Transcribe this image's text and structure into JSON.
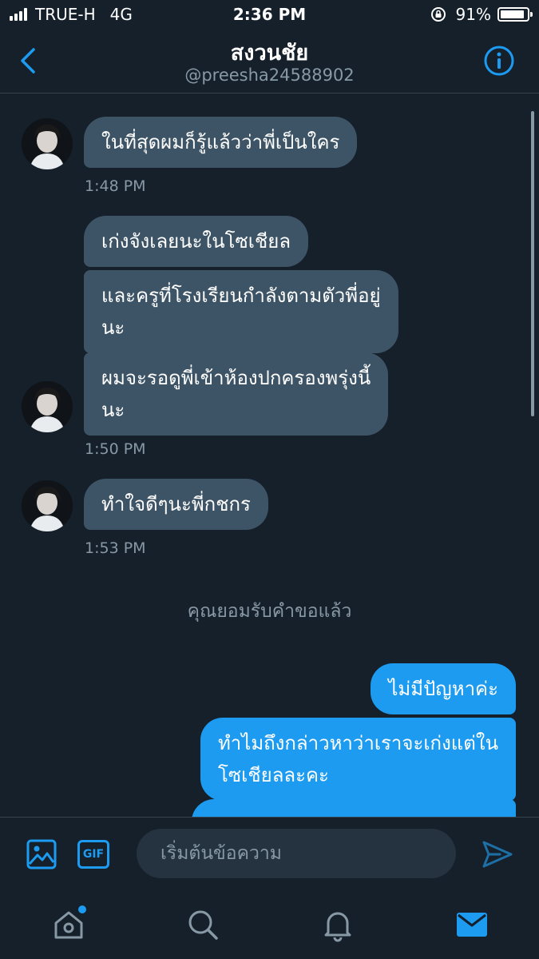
{
  "status_bar": {
    "carrier": "TRUE-H",
    "network": "4G",
    "time": "2:36 PM",
    "battery": "91%",
    "battery_level": 0.91,
    "icons": [
      "signal-icon",
      "rotation-lock-icon",
      "battery-icon"
    ]
  },
  "header": {
    "title": "สงวนชัย",
    "handle": "@preesha24588902",
    "icons": [
      "back-icon",
      "info-icon"
    ]
  },
  "messages": {
    "m1": "ในที่สุดผมก็รู้แล้วว่าพี่เป็นใคร",
    "t1": "1:48 PM",
    "m2": "เก่งจังเลยนะในโซเชียล",
    "m3_line1": "และครูที่โรงเรียนกำลังตามตัวพี่อยู่",
    "m3_line2": "นะ",
    "m4_line1": "ผมจะรอดูพี่เข้าห้องปกครองพรุ่งนี้",
    "m4_line2": "นะ",
    "t2": "1:50 PM",
    "m5": "ทำใจดีๆนะพี่กชกร",
    "t3": "1:53 PM",
    "system": "คุณยอมรับคำขอแล้ว",
    "o1": "ไม่มีปัญหาค่ะ",
    "o2_line1": "ทำไมถึงกล่าวหาว่าเราจะเก่งแต่ใน",
    "o2_line2": "โซเชียลละคะ"
  },
  "composer": {
    "gif_label": "GIF",
    "placeholder": "เริ่มต้นข้อความ",
    "icons": [
      "image-icon",
      "gif-icon",
      "send-icon"
    ]
  },
  "tabbar": {
    "tabs": [
      "home",
      "search",
      "notifications",
      "messages"
    ],
    "active": "messages"
  },
  "colors": {
    "background": "#15202b",
    "incoming_bubble": "#3d5466",
    "outgoing_bubble": "#1d9bf0",
    "accent": "#1d9bf0",
    "secondary_text": "#8899a6"
  }
}
